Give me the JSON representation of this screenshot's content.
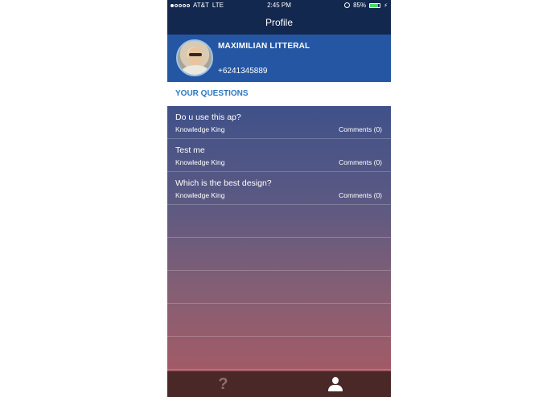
{
  "status_bar": {
    "carrier": "AT&T",
    "network": "LTE",
    "time": "2:45 PM",
    "battery_percent": "85%",
    "battery_level": 0.85,
    "signal_bars_filled": 1,
    "signal_bars_total": 5
  },
  "nav": {
    "title": "Profile"
  },
  "profile": {
    "name": "MAXIMILIAN LITTERAL",
    "phone": "+6241345889"
  },
  "section": {
    "title": "YOUR QUESTIONS"
  },
  "questions": [
    {
      "title": "Do u use this ap?",
      "author": "Knowledge King",
      "comments": "Comments (0)"
    },
    {
      "title": "Test me",
      "author": "Knowledge King",
      "comments": "Comments (0)"
    },
    {
      "title": "Which is the best design?",
      "author": "Knowledge King",
      "comments": "Comments (0)"
    }
  ],
  "tabbar": {
    "help_glyph": "?",
    "help_icon": "question-mark-icon",
    "profile_icon": "user-icon"
  },
  "colors": {
    "nav_bg": "#13284f",
    "profile_bg": "#2456a3",
    "section_title": "#2a78c4",
    "tabbar_bg": "#4a2828"
  }
}
